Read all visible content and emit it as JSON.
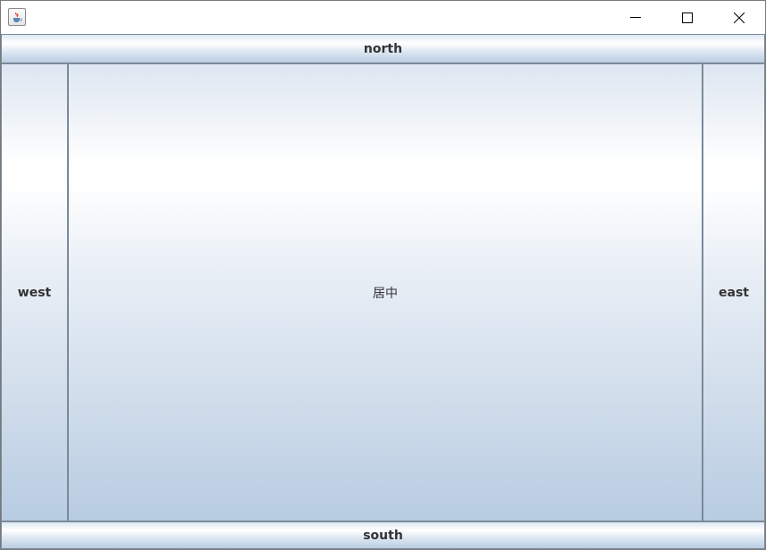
{
  "window": {
    "title": "",
    "controls": {
      "minimize": "minimize-icon",
      "maximize": "maximize-icon",
      "close": "close-icon"
    },
    "app_icon": "java-cup-icon"
  },
  "layout_buttons": {
    "north": "north",
    "west": "west",
    "center": "居中",
    "east": "east",
    "south": "south"
  },
  "colors": {
    "button_text": "#333333",
    "button_border": "#7a8a99",
    "gradient_light": "#ffffff",
    "gradient_dark": "#b8cce2"
  }
}
